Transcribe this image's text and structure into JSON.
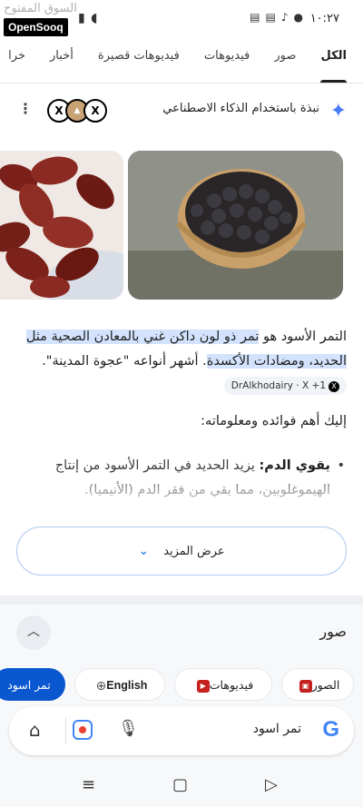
{
  "status_bar": {
    "time": "١٠:٢٧",
    "left_icons": "▮|▸"
  },
  "watermark": {
    "arabic": "السوق المفتوح",
    "logo": "OpenSooq"
  },
  "tabs": [
    {
      "label": "الكل",
      "active": true
    },
    {
      "label": "صور"
    },
    {
      "label": "فيديوهات"
    },
    {
      "label": "فيديوهات قصيرة"
    },
    {
      "label": "أخبار"
    },
    {
      "label": "خرا"
    }
  ],
  "ai_overview": {
    "title": "نبذة باستخدام الذكاء الاصطناعي",
    "text_before": "التمر الأسود هو ",
    "highlight": "تمر ذو لون داكن غني بالمعادن الصحية مثل الحديد، ومضادات الأكسدة",
    "text_after": ". أشهر أنواعه \"عجوة المدينة\".",
    "source_chip": "DrAlkhodairy · X +1",
    "intro": "إليك أهم فوائده ومعلوماته:",
    "bullet_bold": "يقوي الدم:",
    "bullet_text": " يزيد الحديد في التمر الأسود من إنتاج الهيموغلوبين، مما يقي من فقر الدم (الأنيميا).",
    "show_more": "عرض المزيد"
  },
  "images_section": {
    "label": "صور"
  },
  "chips": [
    {
      "label": "الصور"
    },
    {
      "label": "فيديوهات"
    },
    {
      "label": "English"
    },
    {
      "label": "تمر اسود"
    }
  ],
  "search": {
    "query": "تمر اسود"
  },
  "colors": {
    "accent": "#0b57d0",
    "highlight": "#d3e3fd",
    "sparkle": "#4a7cf7"
  }
}
